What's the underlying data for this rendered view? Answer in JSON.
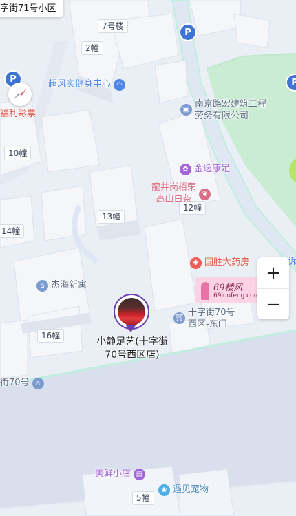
{
  "top_chip": "字街71号小区",
  "building_labels": {
    "b7": "7号楼",
    "b2": "2幢",
    "b10": "10幢",
    "b13": "13幢",
    "b14": "14幢",
    "b12": "12幢",
    "b16": "16幢",
    "b5": "5幢"
  },
  "pois": {
    "gym": "超风实健身中心",
    "construction_line1": "南京路宏建筑工程",
    "construction_line2": "劳务有限公司",
    "lottery": "福利彩票",
    "jinyi": "金逸康足",
    "tea_line1": "龍井岗栢荣",
    "tea_line2": "高山白茶",
    "pharmacy": "国胜大药房",
    "jiehai": "杰海新寓",
    "xizhi_line1": "十字街70号",
    "xizhi_line2": "西区-东门",
    "left70": "街70号",
    "snack": "美鲜小店",
    "pet": "遇见宠物",
    "edge_right": "诉"
  },
  "marker": {
    "title": "小静足艺(十字街70号西区店)"
  },
  "zoom": {
    "plus": "+",
    "minus": "−"
  },
  "watermark": {
    "line1": "69楼风",
    "line2": "69loufeng.com"
  },
  "colors": {
    "park": "#c9ecd3",
    "road": "#dfe7f2",
    "road_edge": "#bfeede",
    "water_band": "#dde3ef",
    "poi_blue": "#4f88e8",
    "poi_purple": "#a667d8",
    "poi_red": "#ee5d55",
    "marker_purple": "#6a3fb0"
  },
  "icons": {
    "parking": "P",
    "compass": "compass-icon",
    "gym": "gym-icon",
    "office": "office-icon",
    "foot": "foot-massage-icon",
    "tea": "tea-icon",
    "pharmacy": "pharmacy-icon",
    "residence": "residence-icon",
    "gate": "gate-icon",
    "shop": "shop-icon",
    "pet": "pet-icon"
  }
}
